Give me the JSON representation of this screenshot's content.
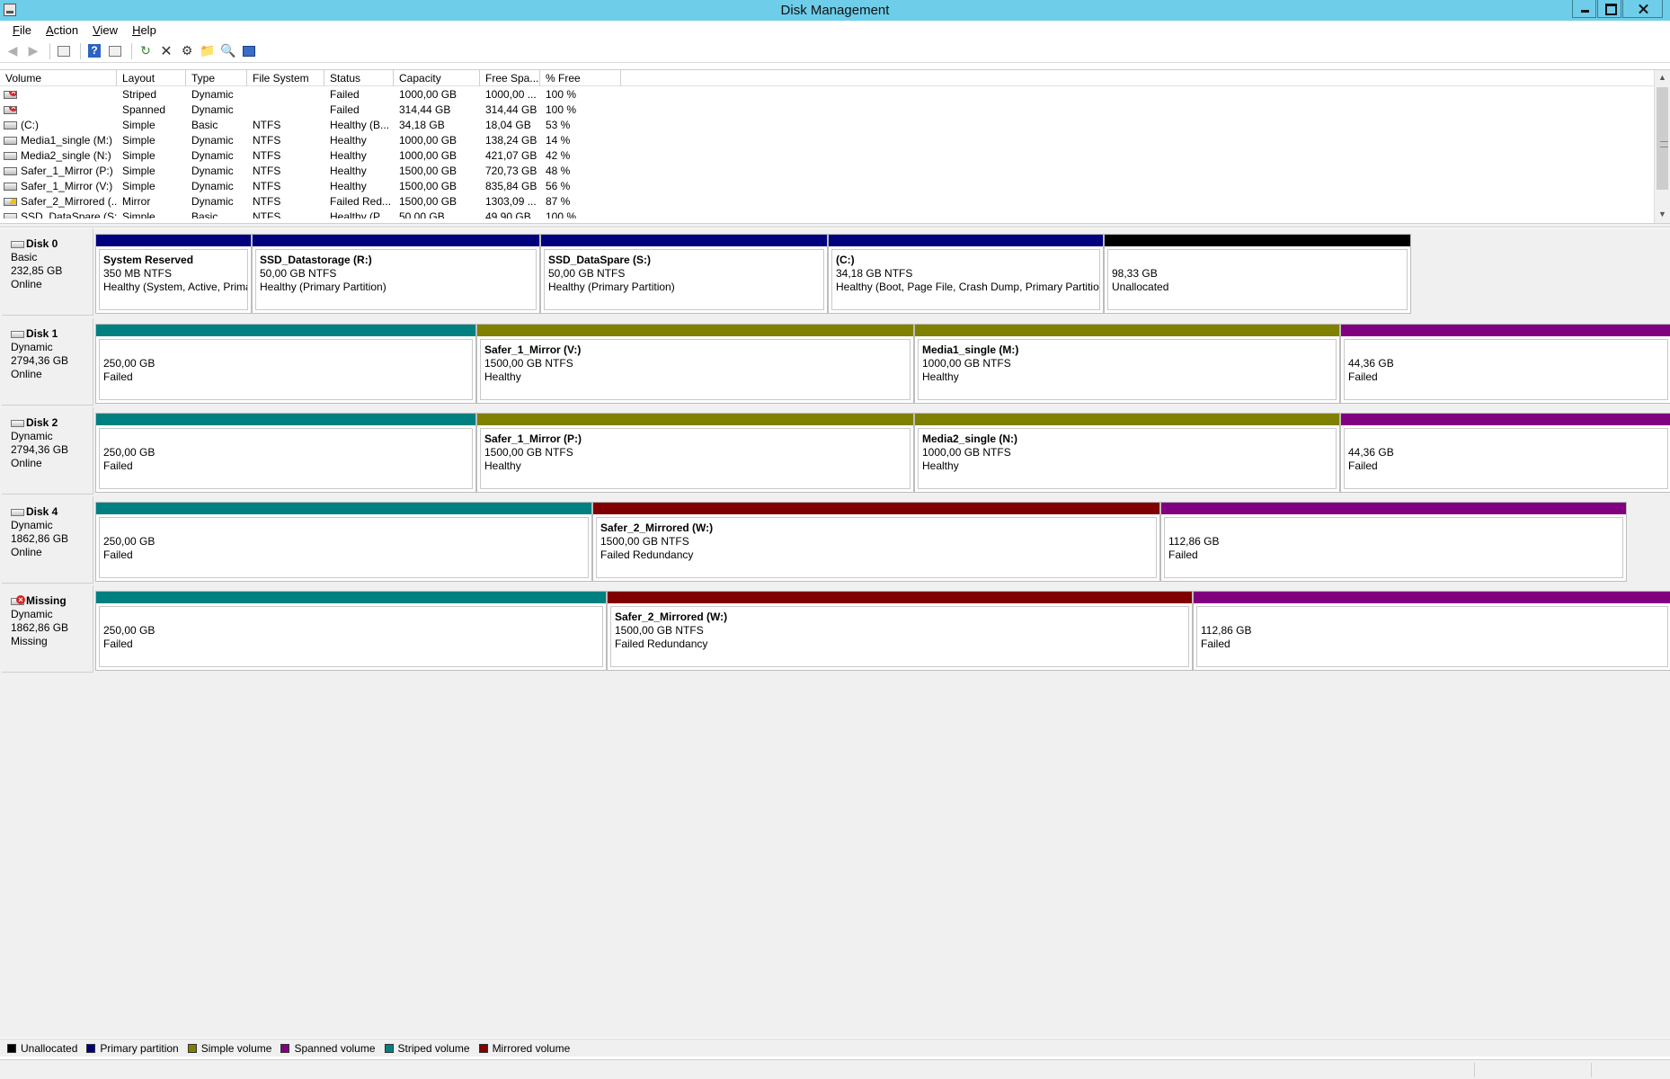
{
  "window": {
    "title": "Disk Management"
  },
  "menu": [
    {
      "first": "F",
      "rest": "ile"
    },
    {
      "first": "A",
      "rest": "ction"
    },
    {
      "first": "V",
      "rest": "iew"
    },
    {
      "first": "H",
      "rest": "elp"
    }
  ],
  "toolbar": {
    "icons": [
      "back-icon",
      "forward-icon",
      "console-tree-icon",
      "help-icon",
      "properties-icon",
      "refresh-icon",
      "delete-icon",
      "settings-icon",
      "open-icon",
      "search-icon",
      "export-icon"
    ]
  },
  "volume_table": {
    "columns": [
      "Volume",
      "Layout",
      "Type",
      "File System",
      "Status",
      "Capacity",
      "Free Spa...",
      "% Free"
    ],
    "rows": [
      {
        "icon": "fail",
        "volume": "",
        "layout": "Striped",
        "type": "Dynamic",
        "fs": "",
        "status": "Failed",
        "capacity": "1000,00 GB",
        "free": "1000,00 ...",
        "pct": "100 %"
      },
      {
        "icon": "fail",
        "volume": "",
        "layout": "Spanned",
        "type": "Dynamic",
        "fs": "",
        "status": "Failed",
        "capacity": "314,44 GB",
        "free": "314,44 GB",
        "pct": "100 %"
      },
      {
        "icon": "ok",
        "volume": "(C:)",
        "layout": "Simple",
        "type": "Basic",
        "fs": "NTFS",
        "status": "Healthy (B...",
        "capacity": "34,18 GB",
        "free": "18,04 GB",
        "pct": "53 %"
      },
      {
        "icon": "ok",
        "volume": "Media1_single (M:)",
        "layout": "Simple",
        "type": "Dynamic",
        "fs": "NTFS",
        "status": "Healthy",
        "capacity": "1000,00 GB",
        "free": "138,24 GB",
        "pct": "14 %"
      },
      {
        "icon": "ok",
        "volume": "Media2_single (N:)",
        "layout": "Simple",
        "type": "Dynamic",
        "fs": "NTFS",
        "status": "Healthy",
        "capacity": "1000,00 GB",
        "free": "421,07 GB",
        "pct": "42 %"
      },
      {
        "icon": "ok",
        "volume": "Safer_1_Mirror (P:)",
        "layout": "Simple",
        "type": "Dynamic",
        "fs": "NTFS",
        "status": "Healthy",
        "capacity": "1500,00 GB",
        "free": "720,73 GB",
        "pct": "48 %"
      },
      {
        "icon": "ok",
        "volume": "Safer_1_Mirror (V:)",
        "layout": "Simple",
        "type": "Dynamic",
        "fs": "NTFS",
        "status": "Healthy",
        "capacity": "1500,00 GB",
        "free": "835,84 GB",
        "pct": "56 %"
      },
      {
        "icon": "warn",
        "volume": "Safer_2_Mirrored (...",
        "layout": "Mirror",
        "type": "Dynamic",
        "fs": "NTFS",
        "status": "Failed Red...",
        "capacity": "1500,00 GB",
        "free": "1303,09 ...",
        "pct": "87 %"
      },
      {
        "icon": "ok",
        "volume": "SSD_DataSpare (S:)",
        "layout": "Simple",
        "type": "Basic",
        "fs": "NTFS",
        "status": "Healthy (P...",
        "capacity": "50,00 GB",
        "free": "49,90 GB",
        "pct": "100 %"
      }
    ]
  },
  "colors": {
    "unallocated": "#000000",
    "primary": "#00007f",
    "simple": "#808000",
    "spanned": "#800080",
    "striped": "#008080",
    "mirrored": "#800000"
  },
  "disks": [
    {
      "name": "Disk 0",
      "icon": "ok",
      "kind": "Basic",
      "size": "232,85 GB",
      "state": "Online",
      "partitions": [
        {
          "kind": "primary",
          "name": "System Reserved",
          "detail": "350 MB NTFS",
          "status": "Healthy (System, Active, Primary Partition)"
        },
        {
          "kind": "primary",
          "name": "SSD_Datastorage  (R:)",
          "detail": "50,00 GB NTFS",
          "status": "Healthy (Primary Partition)"
        },
        {
          "kind": "primary",
          "name": "SSD_DataSpare  (S:)",
          "detail": "50,00 GB NTFS",
          "status": "Healthy (Primary Partition)"
        },
        {
          "kind": "primary",
          "name": " (C:)",
          "detail": "34,18 GB NTFS",
          "status": "Healthy (Boot, Page File, Crash Dump, Primary Partition)"
        },
        {
          "kind": "unallocated",
          "name": "",
          "detail": "98,33 GB",
          "status": "Unallocated"
        }
      ]
    },
    {
      "name": "Disk 1",
      "icon": "ok",
      "kind": "Dynamic",
      "size": "2794,36 GB",
      "state": "Online",
      "partitions": [
        {
          "kind": "striped",
          "name": "",
          "detail": "250,00 GB",
          "status": "Failed"
        },
        {
          "kind": "simple",
          "name": "Safer_1_Mirror  (V:)",
          "detail": "1500,00 GB NTFS",
          "status": "Healthy"
        },
        {
          "kind": "simple",
          "name": "Media1_single  (M:)",
          "detail": "1000,00 GB NTFS",
          "status": "Healthy"
        },
        {
          "kind": "spanned",
          "name": "",
          "detail": "44,36 GB",
          "status": "Failed"
        }
      ]
    },
    {
      "name": "Disk 2",
      "icon": "ok",
      "kind": "Dynamic",
      "size": "2794,36 GB",
      "state": "Online",
      "partitions": [
        {
          "kind": "striped",
          "name": "",
          "detail": "250,00 GB",
          "status": "Failed"
        },
        {
          "kind": "simple",
          "name": "Safer_1_Mirror  (P:)",
          "detail": "1500,00 GB NTFS",
          "status": "Healthy"
        },
        {
          "kind": "simple",
          "name": "Media2_single  (N:)",
          "detail": "1000,00 GB NTFS",
          "status": "Healthy"
        },
        {
          "kind": "spanned",
          "name": "",
          "detail": "44,36 GB",
          "status": "Failed"
        }
      ]
    },
    {
      "name": "Disk 4",
      "icon": "ok",
      "kind": "Dynamic",
      "size": "1862,86 GB",
      "state": "Online",
      "partitions": [
        {
          "kind": "striped",
          "name": "",
          "detail": "250,00 GB",
          "status": "Failed"
        },
        {
          "kind": "mirrored",
          "name": "Safer_2_Mirrored  (W:)",
          "detail": "1500,00 GB NTFS",
          "status": "Failed Redundancy"
        },
        {
          "kind": "spanned",
          "name": "",
          "detail": "112,86 GB",
          "status": "Failed"
        }
      ]
    },
    {
      "name": "Missing",
      "icon": "missing",
      "kind": "Dynamic",
      "size": "1862,86 GB",
      "state": "Missing",
      "partitions": [
        {
          "kind": "striped",
          "name": "",
          "detail": "250,00 GB",
          "status": "Failed"
        },
        {
          "kind": "mirrored",
          "name": "Safer_2_Mirrored  (W:)",
          "detail": "1500,00 GB NTFS",
          "status": "Failed Redundancy"
        },
        {
          "kind": "spanned",
          "name": "",
          "detail": "112,86 GB",
          "status": "Failed"
        }
      ]
    }
  ],
  "legend": [
    {
      "kind": "unallocated",
      "label": "Unallocated"
    },
    {
      "kind": "primary",
      "label": "Primary partition"
    },
    {
      "kind": "simple",
      "label": "Simple volume"
    },
    {
      "kind": "spanned",
      "label": "Spanned volume"
    },
    {
      "kind": "striped",
      "label": "Striped volume"
    },
    {
      "kind": "mirrored",
      "label": "Mirrored volume"
    }
  ]
}
